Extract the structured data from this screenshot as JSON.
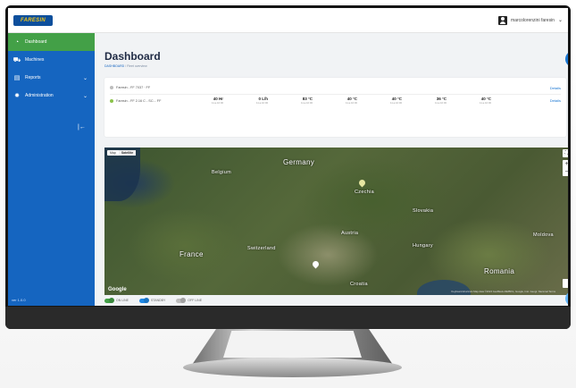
{
  "app": {
    "logo_text": "FARESIN",
    "user_name": "marcolorenzini faresin",
    "version": "ver 1.0.0"
  },
  "sidebar": {
    "items": [
      {
        "label": "Dashboard",
        "icon": "gauge-icon"
      },
      {
        "label": "Machines",
        "icon": "tractor-icon"
      },
      {
        "label": "Reports",
        "icon": "chart-icon"
      },
      {
        "label": "Administration",
        "icon": "gear-icon"
      }
    ]
  },
  "page": {
    "title": "Dashboard",
    "breadcrumb_link": "DASHBOARD",
    "breadcrumb_rest": " / Fleet overview"
  },
  "machines": [
    {
      "name": "Faresin - FF 7037 · FF",
      "status_color": "#bdbdbd",
      "details": "Details",
      "metrics": []
    },
    {
      "name": "Faresin - FF 2.16 C - SC... FF",
      "status_color": "#8bc34a",
      "details": "Details",
      "metrics": [
        {
          "value": "40 Hr",
          "ts": "11.a.10:00"
        },
        {
          "value": "0 L/h",
          "ts": "11.a.10:00"
        },
        {
          "value": "83 °C",
          "ts": "11.a.10:00"
        },
        {
          "value": "40 °C",
          "ts": "11.a.10:00"
        },
        {
          "value": "40 °C",
          "ts": "11.a.10:00"
        },
        {
          "value": "36 °C",
          "ts": "11.a.10:00"
        },
        {
          "value": "40 °C",
          "ts": "11.a.10:00"
        }
      ]
    }
  ],
  "map": {
    "map_button": "Map",
    "satellite_button": "Satellite",
    "countries": [
      "Germany",
      "Belgium",
      "Czechia",
      "Slovakia",
      "Austria",
      "Switzerland",
      "France",
      "Hungary",
      "Romania",
      "Moldova",
      "Croatia"
    ],
    "google": "Google",
    "attribution": "Keyboard shortcuts   Map data ©2024 GeoBasis-DE/BKG, Google, Inst. Geogr. Nacional   Terms"
  },
  "legend": [
    {
      "label": "ON LINE",
      "color": "#43a047"
    },
    {
      "label": "STANDBY",
      "color": "#1e88e5"
    },
    {
      "label": "OFF LINE",
      "color": "#bdbdbd"
    }
  ]
}
